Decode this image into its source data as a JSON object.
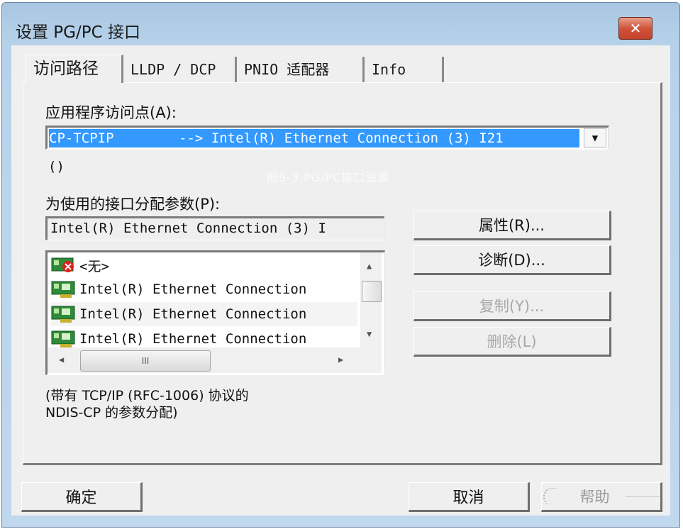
{
  "window": {
    "title": "设置 PG/PC 接口",
    "close_label": "✕"
  },
  "tabs": [
    {
      "label": "访问路径",
      "active": true
    },
    {
      "label": "LLDP / DCP",
      "active": false
    },
    {
      "label": "PNIO 适配器",
      "active": false
    },
    {
      "label": "Info",
      "active": false
    }
  ],
  "access_point": {
    "label": "应用程序访问点(A):",
    "selected_value": "CP-TCPIP        --> Intel(R) Ethernet Connection (3) I21",
    "dropdown_icon": "▼",
    "note": "()"
  },
  "watermark": "图9-3  PG/PC接口设置",
  "interface_params": {
    "label": "为使用的接口分配参数(P):",
    "value": "Intel(R) Ethernet Connection (3) I",
    "list": [
      {
        "icon": "nic-disabled-icon",
        "label": "<无>"
      },
      {
        "icon": "nic-icon",
        "label": "Intel(R) Ethernet Connection"
      },
      {
        "icon": "nic-icon",
        "label": "Intel(R) Ethernet Connection"
      },
      {
        "icon": "nic-icon",
        "label": "Intel(R) Ethernet Connection"
      }
    ],
    "hscroll_grip": "III"
  },
  "side_buttons": {
    "properties": "属性(R)...",
    "diagnostics": "诊断(D)...",
    "copy": "复制(Y)...",
    "delete": "删除(L)"
  },
  "description": {
    "line1": "(带有 TCP/IP (RFC-1006) 协议的",
    "line2": "NDIS-CP 的参数分配)"
  },
  "footer": {
    "ok": "确定",
    "cancel": "取消",
    "help": "帮助"
  }
}
